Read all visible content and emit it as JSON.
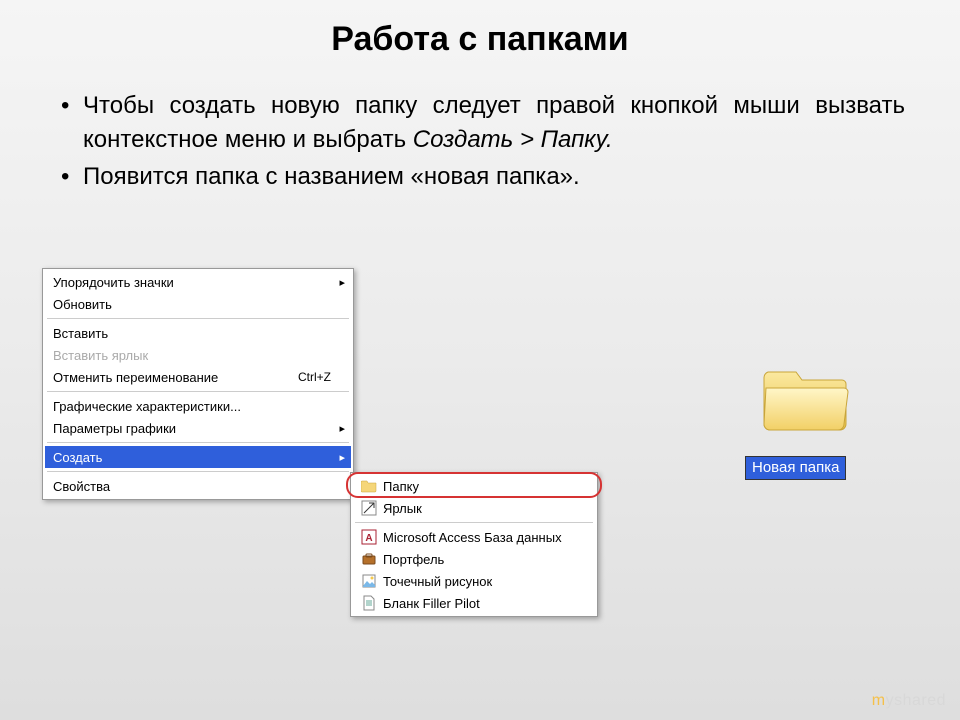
{
  "title": "Работа с папками",
  "bullets": [
    {
      "pre": "Чтобы создать новую папку следует правой кнопкой мыши вызвать контекстное меню и выбрать ",
      "italic": "Создать > Папку."
    },
    {
      "pre": "Появится папка с названием «новая папка».",
      "italic": ""
    }
  ],
  "contextMenu": {
    "items": [
      {
        "label": "Упорядочить значки",
        "type": "arrow"
      },
      {
        "label": "Обновить",
        "type": "plain"
      },
      {
        "sep": true
      },
      {
        "label": "Вставить",
        "type": "plain"
      },
      {
        "label": "Вставить ярлык",
        "type": "disabled"
      },
      {
        "label": "Отменить переименование",
        "shortcut": "Ctrl+Z",
        "type": "plain"
      },
      {
        "sep": true
      },
      {
        "label": "Графические характеристики...",
        "type": "plain"
      },
      {
        "label": "Параметры графики",
        "type": "arrow"
      },
      {
        "sep": true
      },
      {
        "label": "Создать",
        "type": "highlighted-arrow"
      },
      {
        "sep": true
      },
      {
        "label": "Свойства",
        "type": "plain"
      }
    ]
  },
  "submenu": {
    "items": [
      {
        "icon": "folder",
        "label": "Папку"
      },
      {
        "icon": "shortcut",
        "label": "Ярлык"
      },
      {
        "sep": true
      },
      {
        "icon": "access",
        "label": "Microsoft Access База данных"
      },
      {
        "icon": "briefcase",
        "label": "Портфель"
      },
      {
        "icon": "bitmap",
        "label": "Точечный рисунок"
      },
      {
        "icon": "document",
        "label": "Бланк Filler Pilot"
      }
    ]
  },
  "newFolderLabel": "Новая папка",
  "watermark": {
    "text": "myshared",
    "accentIndex": 0
  }
}
